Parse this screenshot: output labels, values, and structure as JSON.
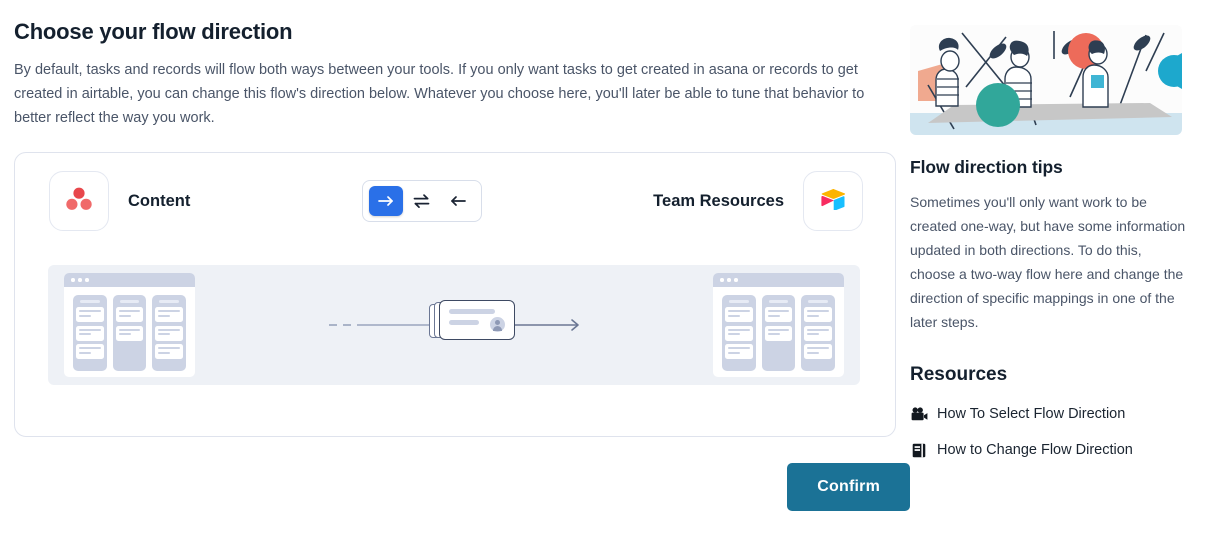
{
  "header": {
    "title": "Choose your flow direction",
    "description": "By default, tasks and records will flow both ways between your tools. If you only want tasks to get created in asana or records to get created in airtable, you can change this flow's direction below. Whatever you choose here, you'll later be able to tune that behavior to better reflect the way you work."
  },
  "flow": {
    "source": {
      "name": "Content",
      "icon": "asana-logo-icon"
    },
    "target": {
      "name": "Team Resources",
      "icon": "airtable-logo-icon"
    },
    "direction_options": [
      {
        "id": "forward",
        "icon": "arrow-right-icon",
        "selected": true
      },
      {
        "id": "two-way",
        "icon": "arrows-bidirectional-icon",
        "selected": false
      },
      {
        "id": "reverse",
        "icon": "arrow-left-icon",
        "selected": false
      }
    ],
    "selected_direction": "forward",
    "accent_color": "#2a70e8"
  },
  "actions": {
    "confirm_label": "Confirm",
    "confirm_color": "#1b7296"
  },
  "sidebar": {
    "hero_image_alt": "people-rowing-boat-illustration",
    "tips_title": "Flow direction tips",
    "tips_body": "Sometimes you'll only want work to be created one-way, but have some information updated in both directions. To do this, choose a two-way flow here and change the direction of specific mappings in one of the later steps.",
    "resources_title": "Resources",
    "resources": [
      {
        "icon": "video-camera-icon",
        "label": "How To Select Flow Direction"
      },
      {
        "icon": "book-icon",
        "label": "How to Change Flow Direction"
      }
    ]
  }
}
